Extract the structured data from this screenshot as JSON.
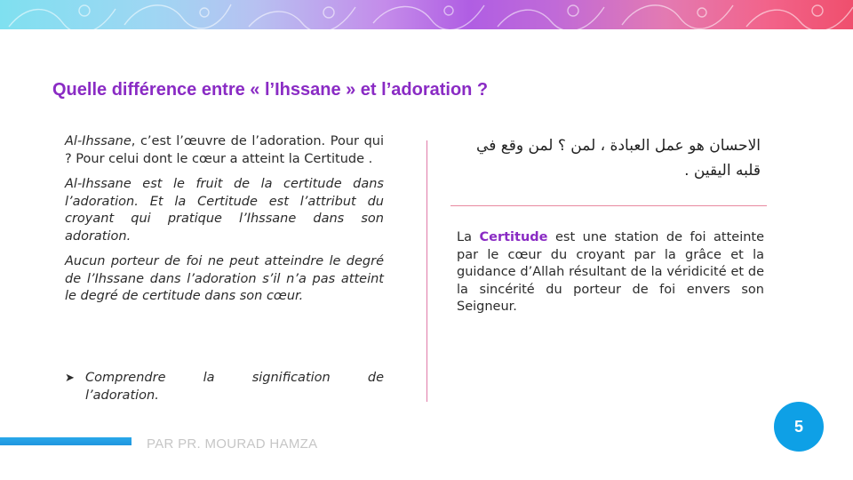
{
  "slide": {
    "title": "Quelle différence entre « l’Ihssane » et l’adoration ?",
    "page_number": "5",
    "author": "PAR PR. MOURAD HAMZA",
    "colors": {
      "title": "#8a2bc4",
      "highlight": "#8a2bc4",
      "badge": "#0ea0e6",
      "footer_bar": "#1f96df",
      "divider": "#e07aa8"
    }
  },
  "left_column": {
    "p1_term": "Al-Ihssane",
    "p1_rest": ", c’est l’œuvre de l’adoration. Pour qui ? Pour celui dont le cœur a atteint la Certitude .",
    "p2": "Al-Ihssane est le fruit de la certitude dans l’adoration. Et la Certitude est l’attribut du croyant qui pratique l’Ihssane dans son adoration.",
    "p3": "Aucun porteur de foi ne peut atteindre le degré de l’Ihssane dans l’adoration s’il n’a pas atteint le degré de certitude dans son cœur.",
    "bullet_line1": "Comprendre la signification de",
    "bullet_line2": "l’adoration."
  },
  "right_column": {
    "arabic_text": "الاحسان هو عمل العبادة ، لمن ؟ لمن وقع في قلبه اليقين .",
    "definition_term": "Certitude",
    "definition_prefix": "La",
    "definition_rest": "est une station de foi atteinte par le cœur du croyant par la grâce et la guidance d’Allah résultant de la véridicité et de la sincérité du porteur de foi envers son Seigneur."
  }
}
